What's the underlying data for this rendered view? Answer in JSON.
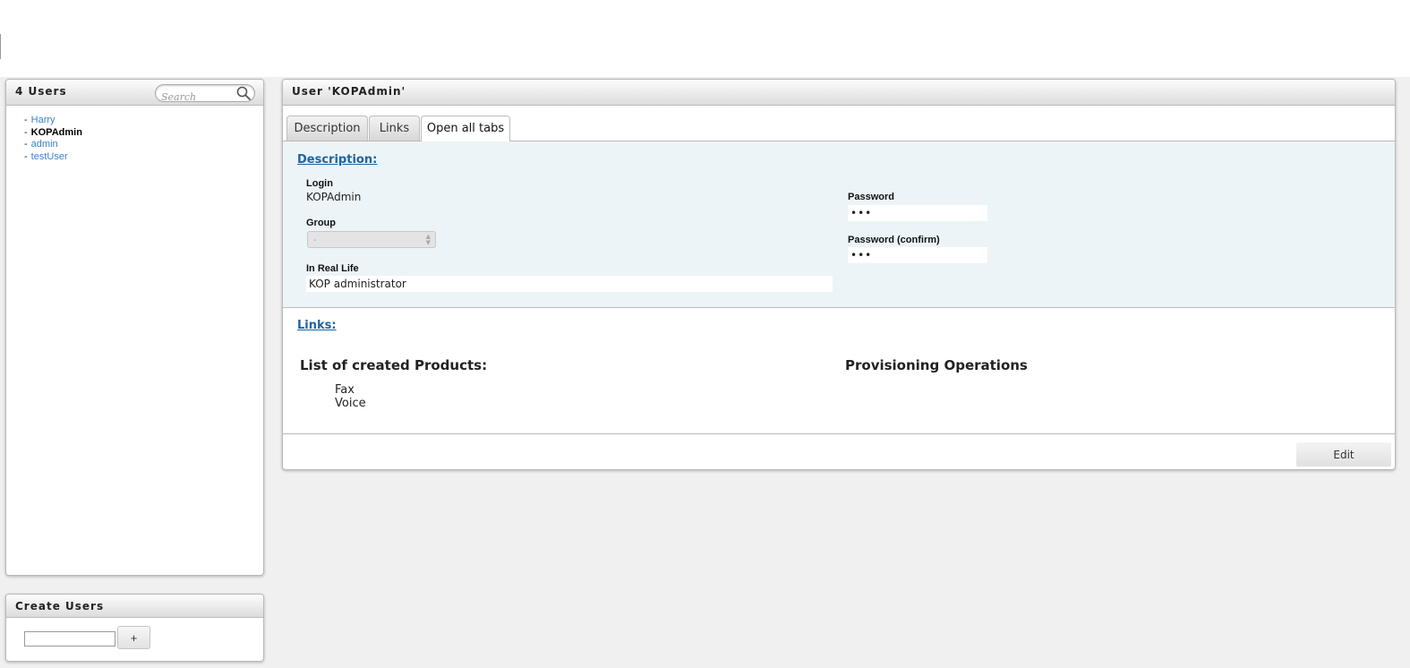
{
  "users_panel": {
    "title": "4 Users",
    "search_placeholder": "Search",
    "items": [
      {
        "dash": "-",
        "label": "Harry"
      },
      {
        "dash": "-",
        "label": "KOPAdmin"
      },
      {
        "dash": "-",
        "label": "admin"
      },
      {
        "dash": "-",
        "label": "testUser"
      }
    ]
  },
  "create_panel": {
    "title": "Create Users",
    "add_label": "+"
  },
  "detail": {
    "title": "User 'KOPAdmin'",
    "tabs": [
      {
        "label": "Description"
      },
      {
        "label": "Links"
      },
      {
        "label": "Open all tabs"
      }
    ],
    "description": {
      "heading": "Description:",
      "login_label": "Login",
      "login_value": "KOPAdmin",
      "group_label": "Group",
      "group_value": "-",
      "real_life_label": "In Real Life",
      "real_life_value": "KOP administrator",
      "password_label": "Password",
      "password_value": "•••",
      "password_confirm_label": "Password (confirm)",
      "password_confirm_value": "•••"
    },
    "links": {
      "heading": "Links:",
      "products_heading": "List of created Products:",
      "products": [
        "Fax",
        "Voice"
      ],
      "provisioning_heading": "Provisioning Operations"
    },
    "edit_label": "Edit"
  }
}
